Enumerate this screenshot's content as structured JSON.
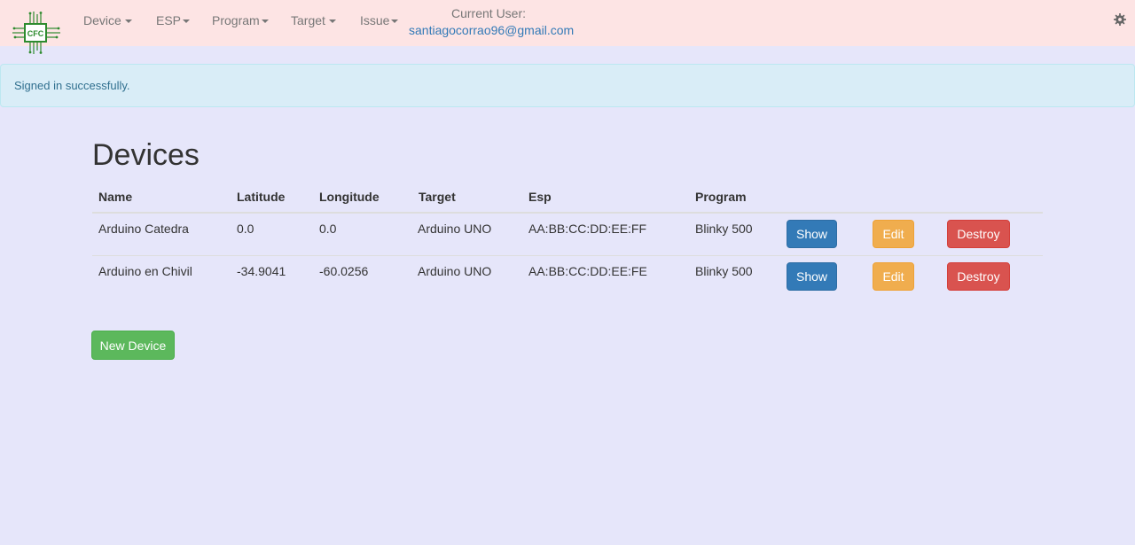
{
  "navbar": {
    "logo_text": "CFC",
    "menus": [
      {
        "label": "Device"
      },
      {
        "label": "ESP"
      },
      {
        "label": "Program"
      },
      {
        "label": "Target"
      },
      {
        "label": "Issue"
      }
    ],
    "current_user_label": "Current User:",
    "current_user_email": "santiagocorrao96@gmail.com",
    "settings_icon": "gear-icon"
  },
  "alert": {
    "message": "Signed in successfully."
  },
  "page": {
    "title": "Devices"
  },
  "table": {
    "columns": [
      "Name",
      "Latitude",
      "Longitude",
      "Target",
      "Esp",
      "Program"
    ],
    "rows": [
      {
        "name": "Arduino Catedra",
        "latitude": "0.0",
        "longitude": "0.0",
        "target": "Arduino UNO",
        "esp": "AA:BB:CC:DD:EE:FF",
        "program": "Blinky 500",
        "actions": {
          "show": "Show",
          "edit": "Edit",
          "destroy": "Destroy"
        }
      },
      {
        "name": "Arduino en Chivil",
        "latitude": "-34.9041",
        "longitude": "-60.0256",
        "target": "Arduino UNO",
        "esp": "AA:BB:CC:DD:EE:FE",
        "program": "Blinky 500",
        "actions": {
          "show": "Show",
          "edit": "Edit",
          "destroy": "Destroy"
        }
      }
    ]
  },
  "new_device_label": "New Device",
  "colors": {
    "navbar_bg": "#fde4e4",
    "page_bg": "#e6e6fa",
    "alert_bg": "#d9edf7",
    "alert_text": "#31708f",
    "link": "#337ab7",
    "show_button": "#337ab7",
    "edit_button": "#f0ad4e",
    "destroy_button": "#d9534f",
    "new_button": "#5cb85c"
  }
}
